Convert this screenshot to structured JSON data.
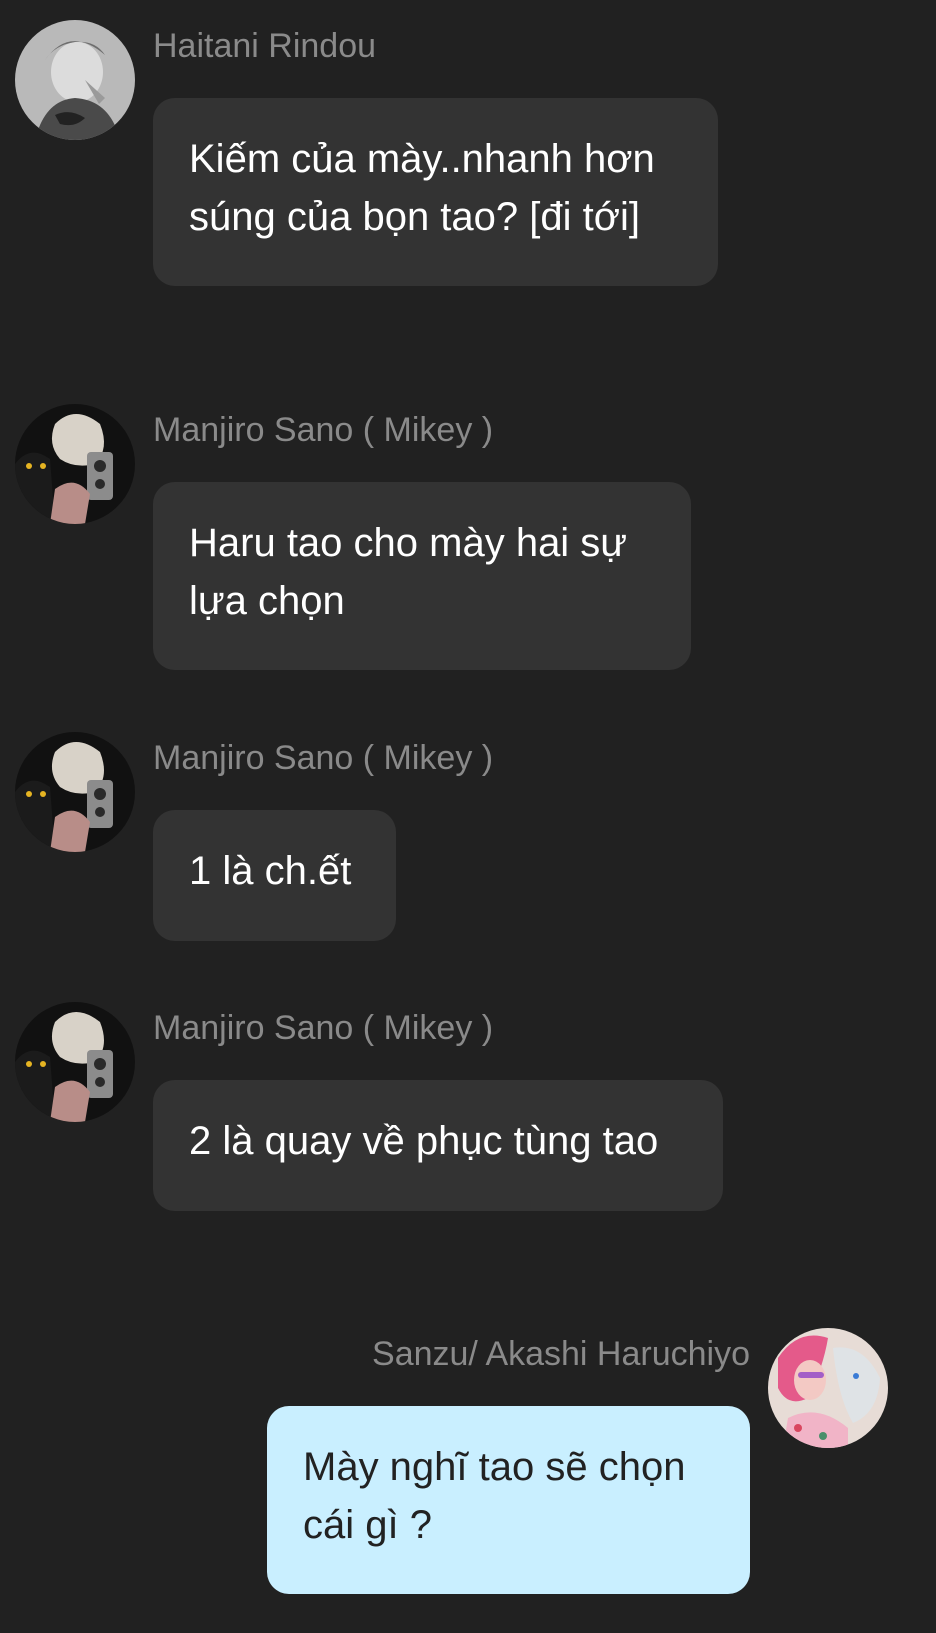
{
  "messages": [
    {
      "sender": "Haitani Rindou",
      "text": "Kiếm của mày..nhanh hơn\nsúng của bọn tao? [đi tới]",
      "avatar": "rindou-avatar"
    },
    {
      "sender": "Manjiro Sano ( Mikey  )",
      "text": "Haru tao cho mày hai sự\nlựa chọn",
      "avatar": "mikey-avatar"
    },
    {
      "sender": "Manjiro Sano ( Mikey  )",
      "text": "1 là ch.ết",
      "avatar": "mikey-avatar"
    },
    {
      "sender": "Manjiro Sano ( Mikey  )",
      "text": "2 là quay về phục tùng tao",
      "avatar": "mikey-avatar"
    },
    {
      "sender": "Sanzu/ Akashi Haruchiyo",
      "text": "Mày nghĩ tao sẽ chọn\ncái gì ?",
      "avatar": "sanzu-avatar"
    }
  ],
  "colors": {
    "background": "#212121",
    "bubble_other": "#333333",
    "bubble_self": "#c9efff",
    "name_text": "#8a8a8a"
  }
}
